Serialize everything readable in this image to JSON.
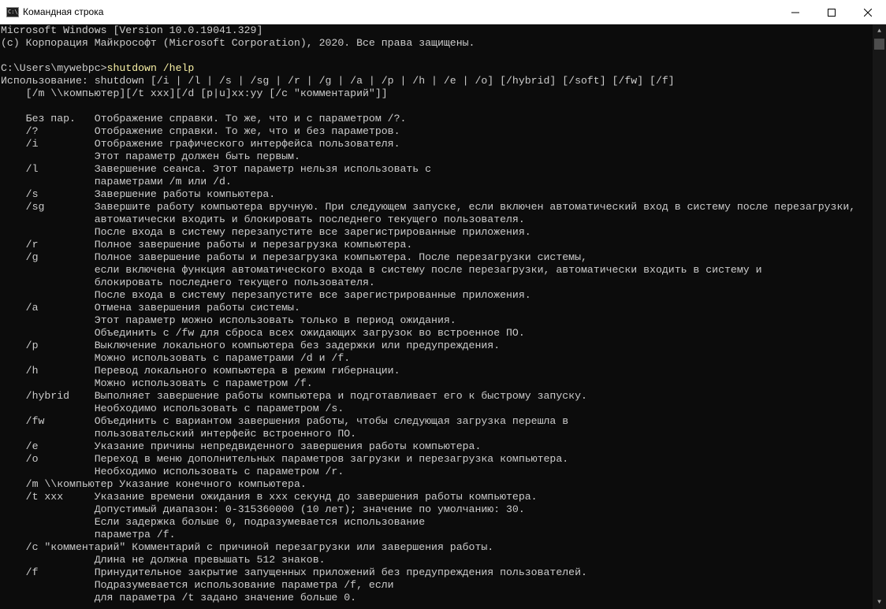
{
  "window": {
    "title": "Командная строка",
    "icon_text": "C:\\_",
    "buttons": {
      "minimize": "minimize-icon",
      "maximize": "maximize-icon",
      "close": "close-icon"
    }
  },
  "console": {
    "prompt": "C:\\Users\\mywebpc>",
    "command": "shutdown /help",
    "lines": [
      "Microsoft Windows [Version 10.0.19041.329]",
      "(c) Корпорация Майкрософт (Microsoft Corporation), 2020. Все права защищены.",
      "",
      "",
      "Использование: shutdown [/i | /l | /s | /sg | /r | /g | /a | /p | /h | /e | /o] [/hybrid] [/soft] [/fw] [/f]",
      "    [/m \\\\компьютер][/t xxx][/d [p|u]xx:yy [/c \"комментарий\"]]",
      "",
      "    Без пар.   Отображение справки. То же, что и с параметром /?.",
      "    /?         Отображение справки. То же, что и без параметров.",
      "    /i         Отображение графического интерфейса пользователя.",
      "               Этот параметр должен быть первым.",
      "    /l         Завершение сеанса. Этот параметр нельзя использовать с",
      "               параметрами /m или /d.",
      "    /s         Завершение работы компьютера.",
      "    /sg        Завершите работу компьютера вручную. При следующем запуске, если включен автоматический вход в систему после перезагрузки,",
      "               автоматически входить и блокировать последнего текущего пользователя.",
      "               После входа в систему перезапустите все зарегистрированные приложения.",
      "    /r         Полное завершение работы и перезагрузка компьютера.",
      "    /g         Полное завершение работы и перезагрузка компьютера. После перезагрузки системы,",
      "               если включена функция автоматического входа в систему после перезагрузки, автоматически входить в систему и",
      "               блокировать последнего текущего пользователя.",
      "               После входа в систему перезапустите все зарегистрированные приложения.",
      "    /a         Отмена завершения работы системы.",
      "               Этот параметр можно использовать только в период ожидания.",
      "               Объединить с /fw для сброса всех ожидающих загрузок во встроенное ПО.",
      "    /p         Выключение локального компьютера без задержки или предупреждения.",
      "               Можно использовать с параметрами /d и /f.",
      "    /h         Перевод локального компьютера в режим гибернации.",
      "               Можно использовать с параметром /f.",
      "    /hybrid    Выполняет завершение работы компьютера и подготавливает его к быстрому запуску.",
      "               Необходимо использовать с параметром /s.",
      "    /fw        Объединить с вариантом завершения работы, чтобы следующая загрузка перешла в",
      "               пользовательский интерфейс встроенного ПО.",
      "    /e         Указание причины непредвиденного завершения работы компьютера.",
      "    /o         Переход в меню дополнительных параметров загрузки и перезагрузка компьютера.",
      "               Необходимо использовать с параметром /r.",
      "    /m \\\\компьютер Указание конечного компьютера.",
      "    /t xxx     Указание времени ожидания в xxx секунд до завершения работы компьютера.",
      "               Допустимый диапазон: 0-315360000 (10 лет); значение по умолчанию: 30.",
      "               Если задержка больше 0, подразумевается использование",
      "               параметра /f.",
      "    /c \"комментарий\" Комментарий с причиной перезагрузки или завершения работы.",
      "               Длина не должна превышать 512 знаков.",
      "    /f         Принудительное закрытие запущенных приложений без предупреждения пользователей.",
      "               Подразумевается использование параметра /f, если",
      "               для параметра /t задано значение больше 0."
    ]
  },
  "colors": {
    "background": "#0c0c0c",
    "text": "#cccccc",
    "command": "#f9f1a5",
    "titlebar": "#ffffff"
  }
}
